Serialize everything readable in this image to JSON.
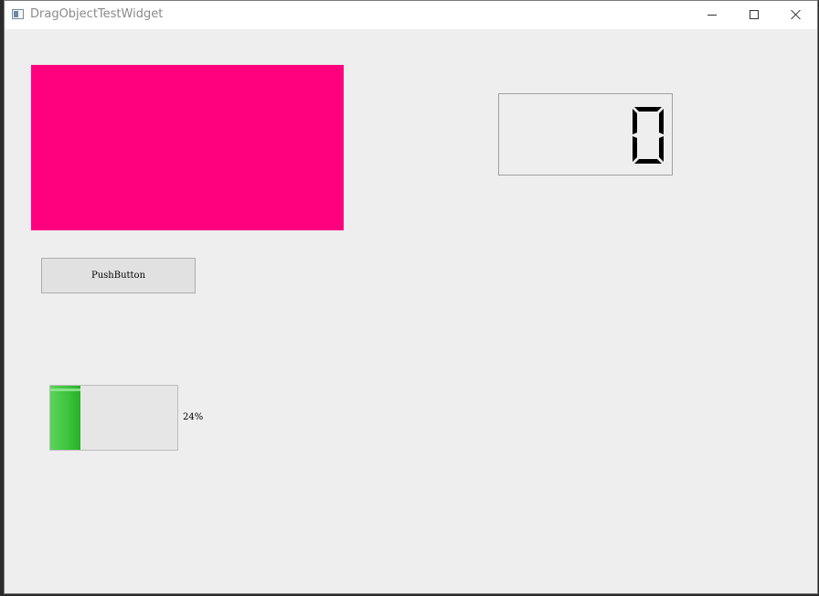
{
  "window": {
    "title": "DragObjectTestWidget"
  },
  "color_rect": {
    "color": "#ff007f"
  },
  "push_button": {
    "label": "PushButton"
  },
  "progress": {
    "value": 0.24,
    "text": "24%",
    "fill_color": "#3dc23d"
  },
  "lcd": {
    "value": "0"
  }
}
